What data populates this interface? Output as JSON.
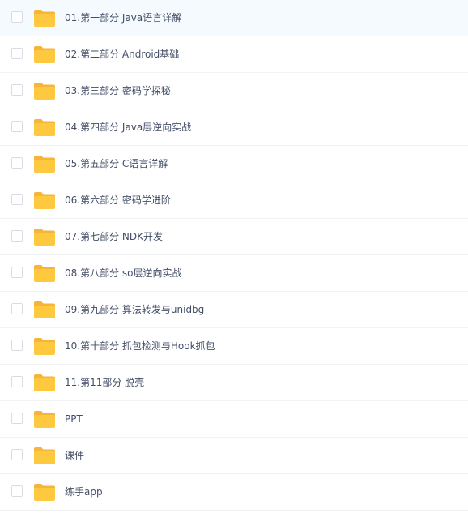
{
  "colors": {
    "folder": "#ffc93f",
    "folder_back": "#f6b43a",
    "text": "#424e67",
    "row_divider": "#f2f3f5",
    "checkbox_border": "#d9dde3"
  },
  "file_list": {
    "items": [
      {
        "name": "01.第一部分 Java语言详解",
        "icon": "folder-icon"
      },
      {
        "name": "02.第二部分 Android基础",
        "icon": "folder-icon"
      },
      {
        "name": "03.第三部分 密码学探秘",
        "icon": "folder-icon"
      },
      {
        "name": "04.第四部分 Java层逆向实战",
        "icon": "folder-icon"
      },
      {
        "name": "05.第五部分 C语言详解",
        "icon": "folder-icon"
      },
      {
        "name": "06.第六部分 密码学进阶",
        "icon": "folder-icon"
      },
      {
        "name": "07.第七部分 NDK开发",
        "icon": "folder-icon"
      },
      {
        "name": "08.第八部分 so层逆向实战",
        "icon": "folder-icon"
      },
      {
        "name": "09.第九部分 算法转发与unidbg",
        "icon": "folder-icon"
      },
      {
        "name": "10.第十部分 抓包检测与Hook抓包",
        "icon": "folder-icon"
      },
      {
        "name": "11.第11部分 脱壳",
        "icon": "folder-icon"
      },
      {
        "name": "PPT",
        "icon": "folder-icon"
      },
      {
        "name": "课件",
        "icon": "folder-icon"
      },
      {
        "name": "练手app",
        "icon": "folder-icon"
      }
    ]
  }
}
